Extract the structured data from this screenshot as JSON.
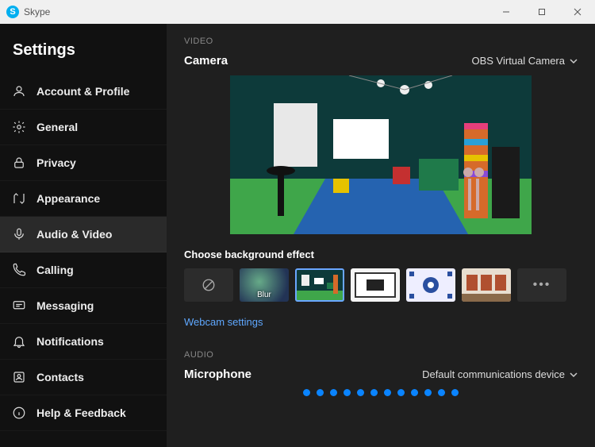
{
  "titlebar": {
    "app_name": "Skype"
  },
  "sidebar": {
    "title": "Settings",
    "items": [
      {
        "label": "Account & Profile"
      },
      {
        "label": "General"
      },
      {
        "label": "Privacy"
      },
      {
        "label": "Appearance"
      },
      {
        "label": "Audio & Video"
      },
      {
        "label": "Calling"
      },
      {
        "label": "Messaging"
      },
      {
        "label": "Notifications"
      },
      {
        "label": "Contacts"
      },
      {
        "label": "Help & Feedback"
      }
    ],
    "active_index": 4
  },
  "video": {
    "section_label": "VIDEO",
    "camera_heading": "Camera",
    "camera_selected": "OBS Virtual Camera",
    "effects_heading": "Choose background effect",
    "effects": {
      "none_label": "None",
      "blur_label": "Blur",
      "more_label": "More"
    },
    "webcam_settings_link": "Webcam settings"
  },
  "audio": {
    "section_label": "AUDIO",
    "mic_heading": "Microphone",
    "mic_selected": "Default communications device",
    "level_dots": 12
  }
}
